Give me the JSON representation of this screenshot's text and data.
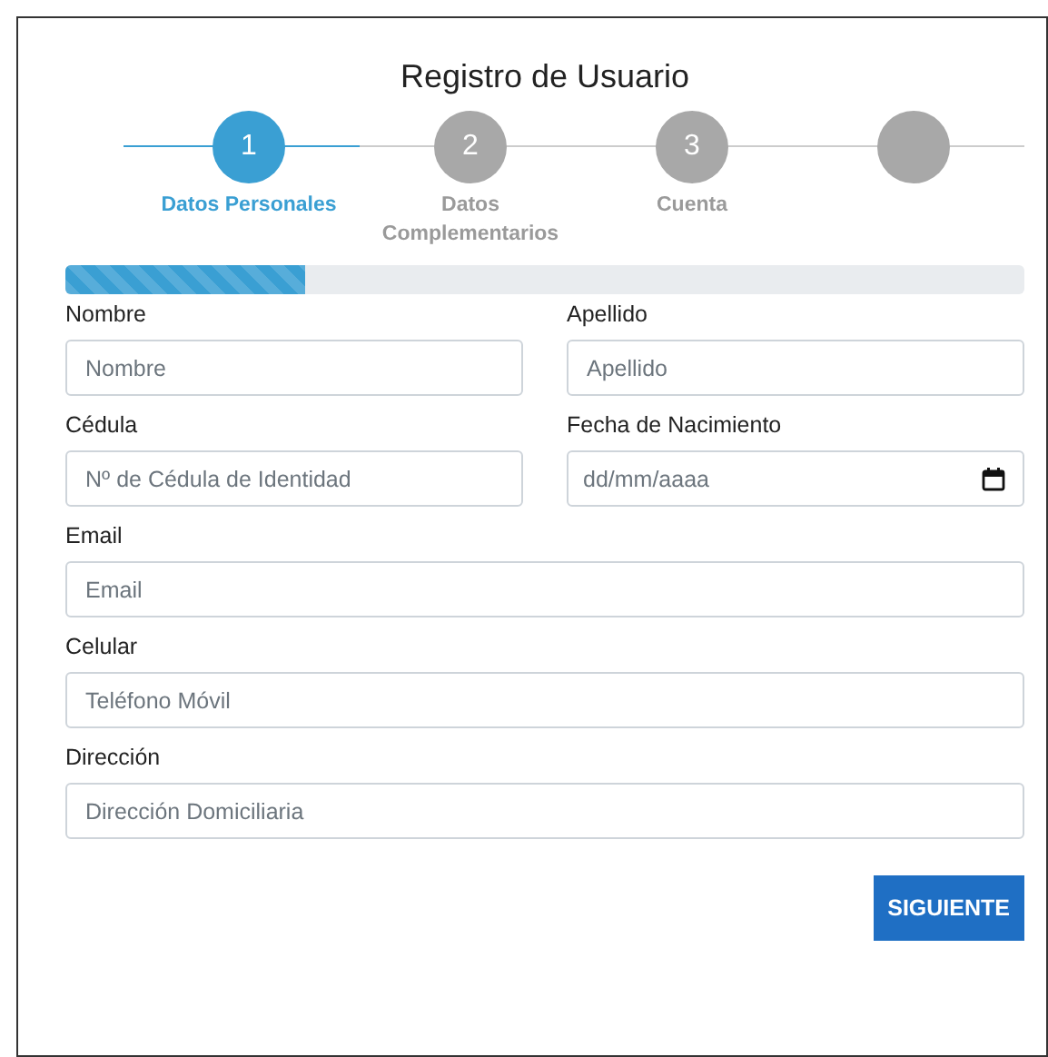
{
  "title": "Registro de Usuario",
  "steps": [
    {
      "number": "1",
      "label": "Datos Personales",
      "active": true
    },
    {
      "number": "2",
      "label": "Datos Complementarios",
      "active": false
    },
    {
      "number": "3",
      "label": "Cuenta",
      "active": false
    },
    {
      "active": false
    }
  ],
  "progress": {
    "level": 0.25
  },
  "fields": [
    {
      "kind": "text",
      "label": "Nombre",
      "placeholder": "Nombre",
      "half": true
    },
    {
      "kind": "text",
      "label": "Apellido",
      "placeholder": "Apellido",
      "half": true
    },
    {
      "kind": "text",
      "label": "Cédula",
      "placeholder": "Nº de Cédula de Identidad",
      "half": true
    },
    {
      "kind": "date",
      "label": "Fecha de Nacimiento",
      "placeholder": "dd/mm/aaaa",
      "half": true
    },
    {
      "kind": "text",
      "label": "Email",
      "placeholder": "Email",
      "half": false
    },
    {
      "kind": "text",
      "label": "Celular",
      "placeholder": "Teléfono Móvil",
      "half": false
    },
    {
      "kind": "text",
      "label": "Dirección",
      "placeholder": "Dirección Domiciliaria",
      "half": false
    }
  ],
  "button": "SIGUIENTE"
}
